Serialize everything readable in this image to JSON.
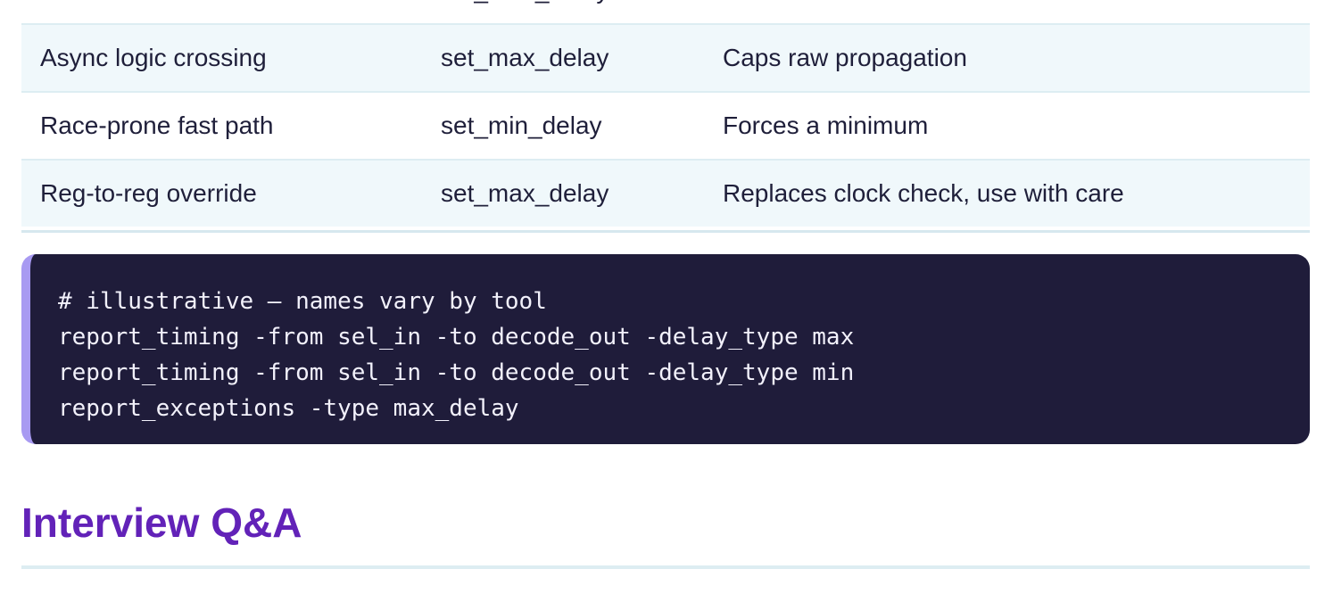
{
  "table": {
    "rows": [
      [
        "",
        "set_max_delay",
        ""
      ],
      [
        "Async logic crossing",
        "set_max_delay",
        "Caps raw propagation"
      ],
      [
        "Race-prone fast path",
        "set_min_delay",
        "Forces a minimum"
      ],
      [
        "Reg-to-reg override",
        "set_max_delay",
        "Replaces clock check, use with care"
      ]
    ]
  },
  "code": {
    "lines": [
      "# illustrative — names vary by tool",
      "report_timing -from sel_in -to decode_out -delay_type max",
      "report_timing -from sel_in -to decode_out -delay_type min",
      "report_exceptions -type max_delay"
    ]
  },
  "section": {
    "title": "Interview Q&A"
  }
}
